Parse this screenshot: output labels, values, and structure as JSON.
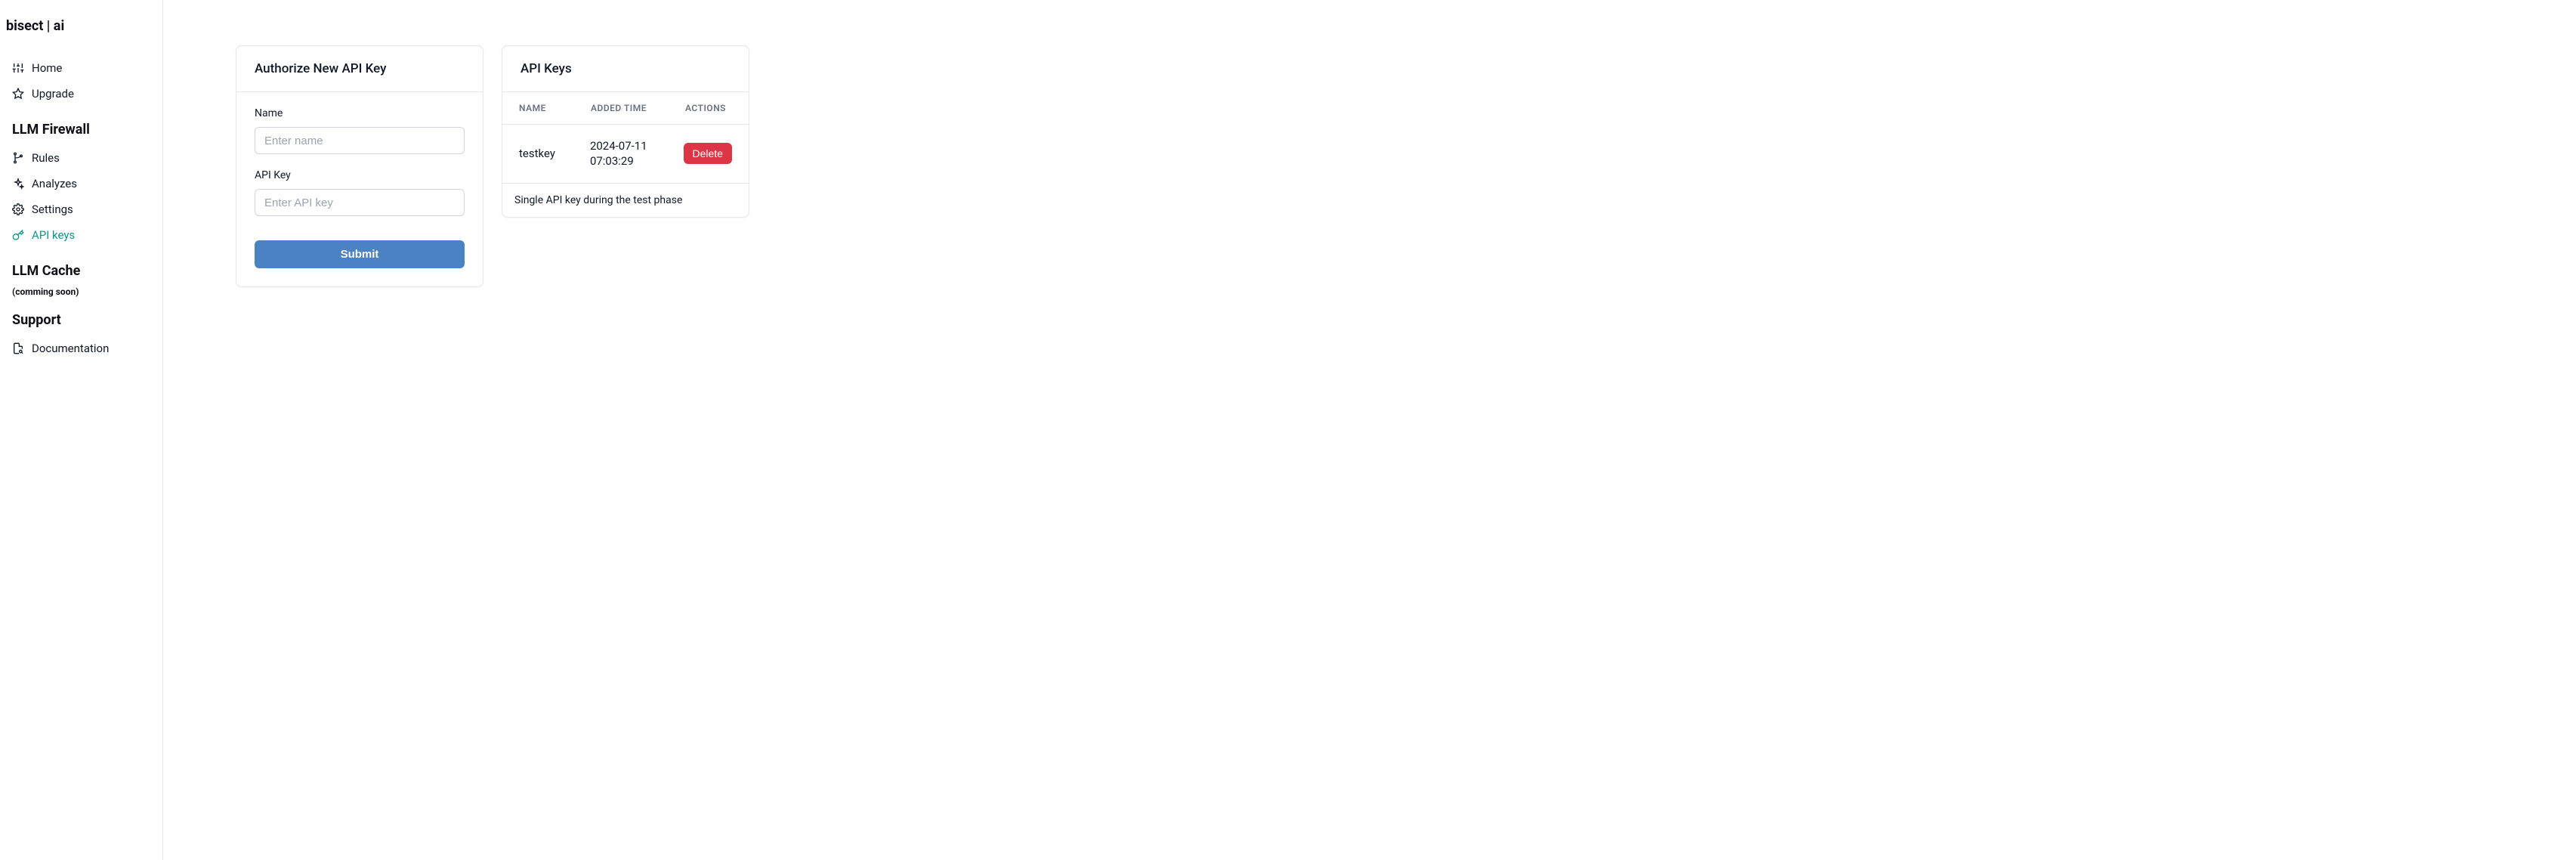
{
  "brand": "bisect | ai",
  "sidebar": {
    "top_items": [
      {
        "label": "Home"
      },
      {
        "label": "Upgrade"
      }
    ],
    "sections": [
      {
        "title": "LLM Firewall",
        "items": [
          {
            "label": "Rules"
          },
          {
            "label": "Analyzes"
          },
          {
            "label": "Settings"
          },
          {
            "label": "API keys",
            "active": true
          }
        ]
      },
      {
        "title": "LLM Cache",
        "note": "(comming soon)",
        "items": []
      },
      {
        "title": "Support",
        "items": [
          {
            "label": "Documentation"
          }
        ]
      }
    ]
  },
  "form_card": {
    "title": "Authorize New API Key",
    "name_label": "Name",
    "name_placeholder": "Enter name",
    "apikey_label": "API Key",
    "apikey_placeholder": "Enter API key",
    "submit_label": "Submit"
  },
  "keys_card": {
    "title": "API Keys",
    "columns": {
      "name": "NAME",
      "time": "ADDED TIME",
      "actions": "ACTIONS"
    },
    "rows": [
      {
        "name": "testkey",
        "time": "2024-07-11 07:03:29",
        "delete_label": "Delete"
      }
    ],
    "footer_note": "Single API key during the test phase"
  }
}
